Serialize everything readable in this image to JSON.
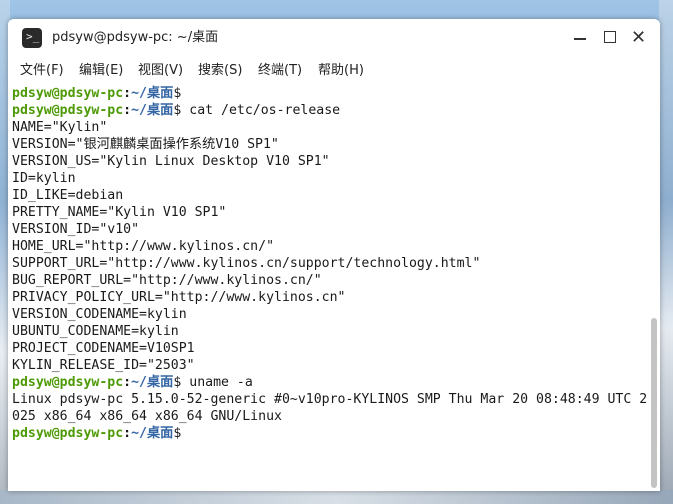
{
  "window": {
    "title": "pdsyw@pdsyw-pc: ~/桌面",
    "icon": "terminal-icon",
    "icon_prompt": ">_"
  },
  "menu": {
    "items": [
      "文件(F)",
      "编辑(E)",
      "视图(V)",
      "搜索(S)",
      "终端(T)",
      "帮助(H)"
    ]
  },
  "prompt": {
    "user_host": "pdsyw@pdsyw-pc",
    "separator": ":",
    "path": "~/桌面",
    "dollar": "$"
  },
  "terminal": {
    "lines": [
      {
        "type": "prompt",
        "command": ""
      },
      {
        "type": "prompt",
        "command": " cat /etc/os-release"
      },
      {
        "type": "output",
        "text": "NAME=\"Kylin\""
      },
      {
        "type": "output",
        "text": "VERSION=\"银河麒麟桌面操作系统V10 SP1\""
      },
      {
        "type": "output",
        "text": "VERSION_US=\"Kylin Linux Desktop V10 SP1\""
      },
      {
        "type": "output",
        "text": "ID=kylin"
      },
      {
        "type": "output",
        "text": "ID_LIKE=debian"
      },
      {
        "type": "output",
        "text": "PRETTY_NAME=\"Kylin V10 SP1\""
      },
      {
        "type": "output",
        "text": "VERSION_ID=\"v10\""
      },
      {
        "type": "output",
        "text": "HOME_URL=\"http://www.kylinos.cn/\""
      },
      {
        "type": "output",
        "text": "SUPPORT_URL=\"http://www.kylinos.cn/support/technology.html\""
      },
      {
        "type": "output",
        "text": "BUG_REPORT_URL=\"http://www.kylinos.cn/\""
      },
      {
        "type": "output",
        "text": "PRIVACY_POLICY_URL=\"http://www.kylinos.cn\""
      },
      {
        "type": "output",
        "text": "VERSION_CODENAME=kylin"
      },
      {
        "type": "output",
        "text": "UBUNTU_CODENAME=kylin"
      },
      {
        "type": "output",
        "text": "PROJECT_CODENAME=V10SP1"
      },
      {
        "type": "output",
        "text": "KYLIN_RELEASE_ID=\"2503\""
      },
      {
        "type": "prompt",
        "command": " uname -a"
      },
      {
        "type": "output",
        "text": "Linux pdsyw-pc 5.15.0-52-generic #0~v10pro-KYLINOS SMP Thu Mar 20 08:48:49 UTC 2"
      },
      {
        "type": "output",
        "text": "025 x86_64 x86_64 x86_64 GNU/Linux"
      },
      {
        "type": "prompt",
        "command": " "
      }
    ]
  },
  "colors": {
    "prompt_user": "#4e9a06",
    "prompt_path": "#3465a4",
    "text": "#1a1a1a",
    "background": "#ffffff"
  }
}
